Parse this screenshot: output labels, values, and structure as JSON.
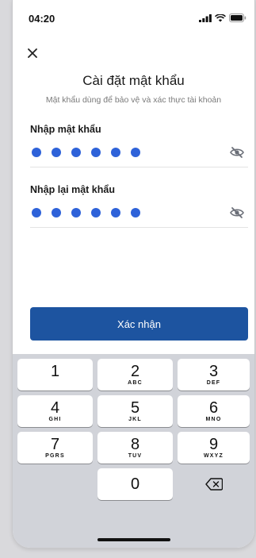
{
  "status_bar": {
    "time": "04:20"
  },
  "header": {
    "title": "Cài đặt mật khẩu",
    "subtitle": "Mật khẩu dùng để bảo vệ và xác thực tài khoản"
  },
  "fields": [
    {
      "label": "Nhập mật khẩu",
      "filled_digits": 6
    },
    {
      "label": "Nhập lại mật khẩu",
      "filled_digits": 6
    }
  ],
  "confirm_button": {
    "label": "Xác nhận"
  },
  "keyboard": {
    "keys": [
      {
        "number": "1",
        "letters": ""
      },
      {
        "number": "2",
        "letters": "ABC"
      },
      {
        "number": "3",
        "letters": "DEF"
      },
      {
        "number": "4",
        "letters": "GHI"
      },
      {
        "number": "5",
        "letters": "JKL"
      },
      {
        "number": "6",
        "letters": "MNO"
      },
      {
        "number": "7",
        "letters": "PGRS"
      },
      {
        "number": "8",
        "letters": "TUV"
      },
      {
        "number": "9",
        "letters": "WXYZ"
      },
      {
        "number": "0",
        "letters": ""
      }
    ]
  },
  "colors": {
    "accent": "#2e62d9",
    "button": "#1d54a0"
  }
}
